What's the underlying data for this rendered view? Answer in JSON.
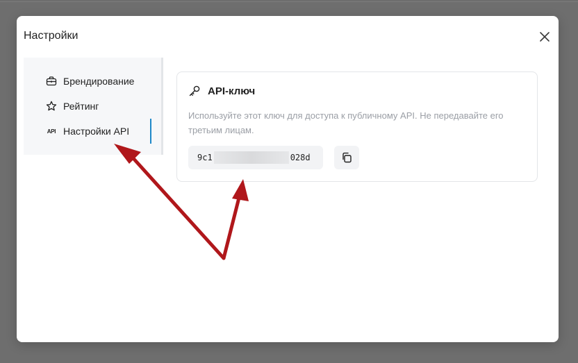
{
  "modal": {
    "title": "Настройки"
  },
  "sidebar": {
    "items": [
      {
        "label": "Брендирование",
        "icon": "briefcase-icon"
      },
      {
        "label": "Рейтинг",
        "icon": "star-icon"
      },
      {
        "label": "Настройки API",
        "icon": "api-icon",
        "icon_text": "API",
        "active": true
      }
    ]
  },
  "api_card": {
    "title": "API-ключ",
    "icon": "key-icon",
    "description": "Используйте этот ключ для доступа к публичному API. Не передавайте его третьим лицам.",
    "key_prefix": "9c1",
    "key_suffix": "028d",
    "copy_icon": "copy-icon"
  },
  "colors": {
    "accent": "#1e88c9",
    "annotation_arrow": "#b0171b",
    "overlay": "#6e6e6e"
  }
}
